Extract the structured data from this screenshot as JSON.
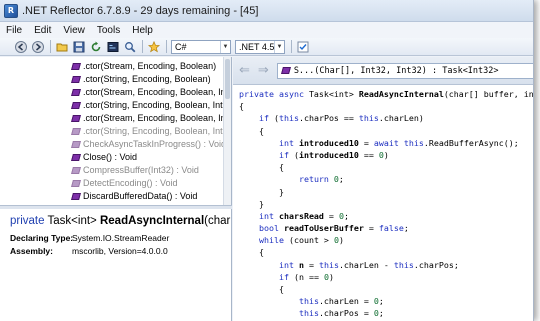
{
  "window": {
    "title": ".NET Reflector 6.7.8.9 - 29 days remaining - [45]",
    "app_icon_glyph": "R"
  },
  "menu": [
    "File",
    "Edit",
    "View",
    "Tools",
    "Help"
  ],
  "toolbar": {
    "language": "C#",
    "framework": ".NET 4.5",
    "icons": [
      "back-icon",
      "forward-icon",
      "open-icon",
      "save-icon",
      "refresh-icon",
      "code-icon",
      "search-icon",
      "favorite-star-icon",
      "toggle-icon"
    ]
  },
  "tree": {
    "items": [
      {
        "label": ".ctor(Stream, Encoding, Boolean)",
        "dimmed": false
      },
      {
        "label": ".ctor(String, Encoding, Boolean)",
        "dimmed": false
      },
      {
        "label": ".ctor(Stream, Encoding, Boolean, Int3",
        "dimmed": false
      },
      {
        "label": ".ctor(String, Encoding, Boolean, Int3",
        "dimmed": false
      },
      {
        "label": ".ctor(Stream, Encoding, Boolean, Int3",
        "dimmed": false
      },
      {
        "label": ".ctor(String, Encoding, Boolean, Int3",
        "dimmed": true
      },
      {
        "label": "CheckAsyncTaskInProgress() : Void",
        "dimmed": true
      },
      {
        "label": "Close() : Void",
        "dimmed": false
      },
      {
        "label": "CompressBuffer(Int32) : Void",
        "dimmed": true
      },
      {
        "label": "DetectEncoding() : Void",
        "dimmed": true
      },
      {
        "label": "DiscardBufferedData() : Void",
        "dimmed": false
      }
    ]
  },
  "info": {
    "sig_modifier": "private",
    "sig_type": "Task<int>",
    "sig_name": "ReadAsyncInternal",
    "sig_params": "(char[] b",
    "declaring_label": "Declaring Type:",
    "declaring_value": "System.IO.StreamReader",
    "assembly_label": "Assembly:",
    "assembly_value": "mscorlib, Version=4.0.0.0"
  },
  "code_nav": {
    "back": "⇐",
    "forward": "⇒",
    "member": "S...(Char[], Int32, Int32) : Task<Int32>"
  },
  "code": {
    "lines": [
      [
        [
          "kw",
          "private async "
        ],
        [
          "t",
          "Task<int> "
        ],
        [
          "b",
          "ReadAsyncInternal"
        ],
        [
          "t",
          "(char[] buffer, int i"
        ]
      ],
      [
        [
          "t",
          "{"
        ]
      ],
      [
        [
          "t",
          "    "
        ],
        [
          "kw",
          "if "
        ],
        [
          "t",
          "("
        ],
        [
          "kw",
          "this"
        ],
        [
          "t",
          ".charPos == "
        ],
        [
          "kw",
          "this"
        ],
        [
          "t",
          ".charLen)"
        ]
      ],
      [
        [
          "t",
          "    {"
        ]
      ],
      [
        [
          "t",
          "        "
        ],
        [
          "kw",
          "int "
        ],
        [
          "b",
          "introduced10"
        ],
        [
          "t",
          " = "
        ],
        [
          "kw",
          "await this"
        ],
        [
          "t",
          ".ReadBufferAsync();"
        ]
      ],
      [
        [
          "t",
          "        "
        ],
        [
          "kw",
          "if "
        ],
        [
          "t",
          "("
        ],
        [
          "b",
          "introduced10"
        ],
        [
          "t",
          " == "
        ],
        [
          "num",
          "0"
        ],
        [
          "t",
          ")"
        ]
      ],
      [
        [
          "t",
          "        {"
        ]
      ],
      [
        [
          "t",
          "            "
        ],
        [
          "kw",
          "return "
        ],
        [
          "num",
          "0"
        ],
        [
          "t",
          ";"
        ]
      ],
      [
        [
          "t",
          "        }"
        ]
      ],
      [
        [
          "t",
          "    }"
        ]
      ],
      [
        [
          "t",
          "    "
        ],
        [
          "kw",
          "int "
        ],
        [
          "b",
          "charsRead"
        ],
        [
          "t",
          " = "
        ],
        [
          "num",
          "0"
        ],
        [
          "t",
          ";"
        ]
      ],
      [
        [
          "t",
          "    "
        ],
        [
          "kw",
          "bool "
        ],
        [
          "b",
          "readToUserBuffer"
        ],
        [
          "t",
          " = "
        ],
        [
          "kw",
          "false"
        ],
        [
          "t",
          ";"
        ]
      ],
      [
        [
          "t",
          "    "
        ],
        [
          "kw",
          "while "
        ],
        [
          "t",
          "(count > "
        ],
        [
          "num",
          "0"
        ],
        [
          "t",
          ")"
        ]
      ],
      [
        [
          "t",
          "    {"
        ]
      ],
      [
        [
          "t",
          "        "
        ],
        [
          "kw",
          "int "
        ],
        [
          "b",
          "n"
        ],
        [
          "t",
          " = "
        ],
        [
          "kw",
          "this"
        ],
        [
          "t",
          ".charLen - "
        ],
        [
          "kw",
          "this"
        ],
        [
          "t",
          ".charPos;"
        ]
      ],
      [
        [
          "t",
          "        "
        ],
        [
          "kw",
          "if "
        ],
        [
          "t",
          "(n == "
        ],
        [
          "num",
          "0"
        ],
        [
          "t",
          ")"
        ]
      ],
      [
        [
          "t",
          "        {"
        ]
      ],
      [
        [
          "t",
          "            "
        ],
        [
          "kw",
          "this"
        ],
        [
          "t",
          ".charLen = "
        ],
        [
          "num",
          "0"
        ],
        [
          "t",
          ";"
        ]
      ],
      [
        [
          "t",
          "            "
        ],
        [
          "kw",
          "this"
        ],
        [
          "t",
          ".charPos = "
        ],
        [
          "num",
          "0"
        ],
        [
          "t",
          ";"
        ]
      ],
      [
        [
          "t",
          "            "
        ],
        [
          "kw",
          "if"
        ],
        [
          "t",
          " (!"
        ],
        [
          "kw",
          "this"
        ],
        [
          "t",
          ".chec"
        ]
      ]
    ]
  },
  "colors": {
    "keyword": "#1d2fc0",
    "number": "#0b6b2d",
    "method_icon": "#7d2fa8",
    "chrome": "#eef2f8"
  }
}
